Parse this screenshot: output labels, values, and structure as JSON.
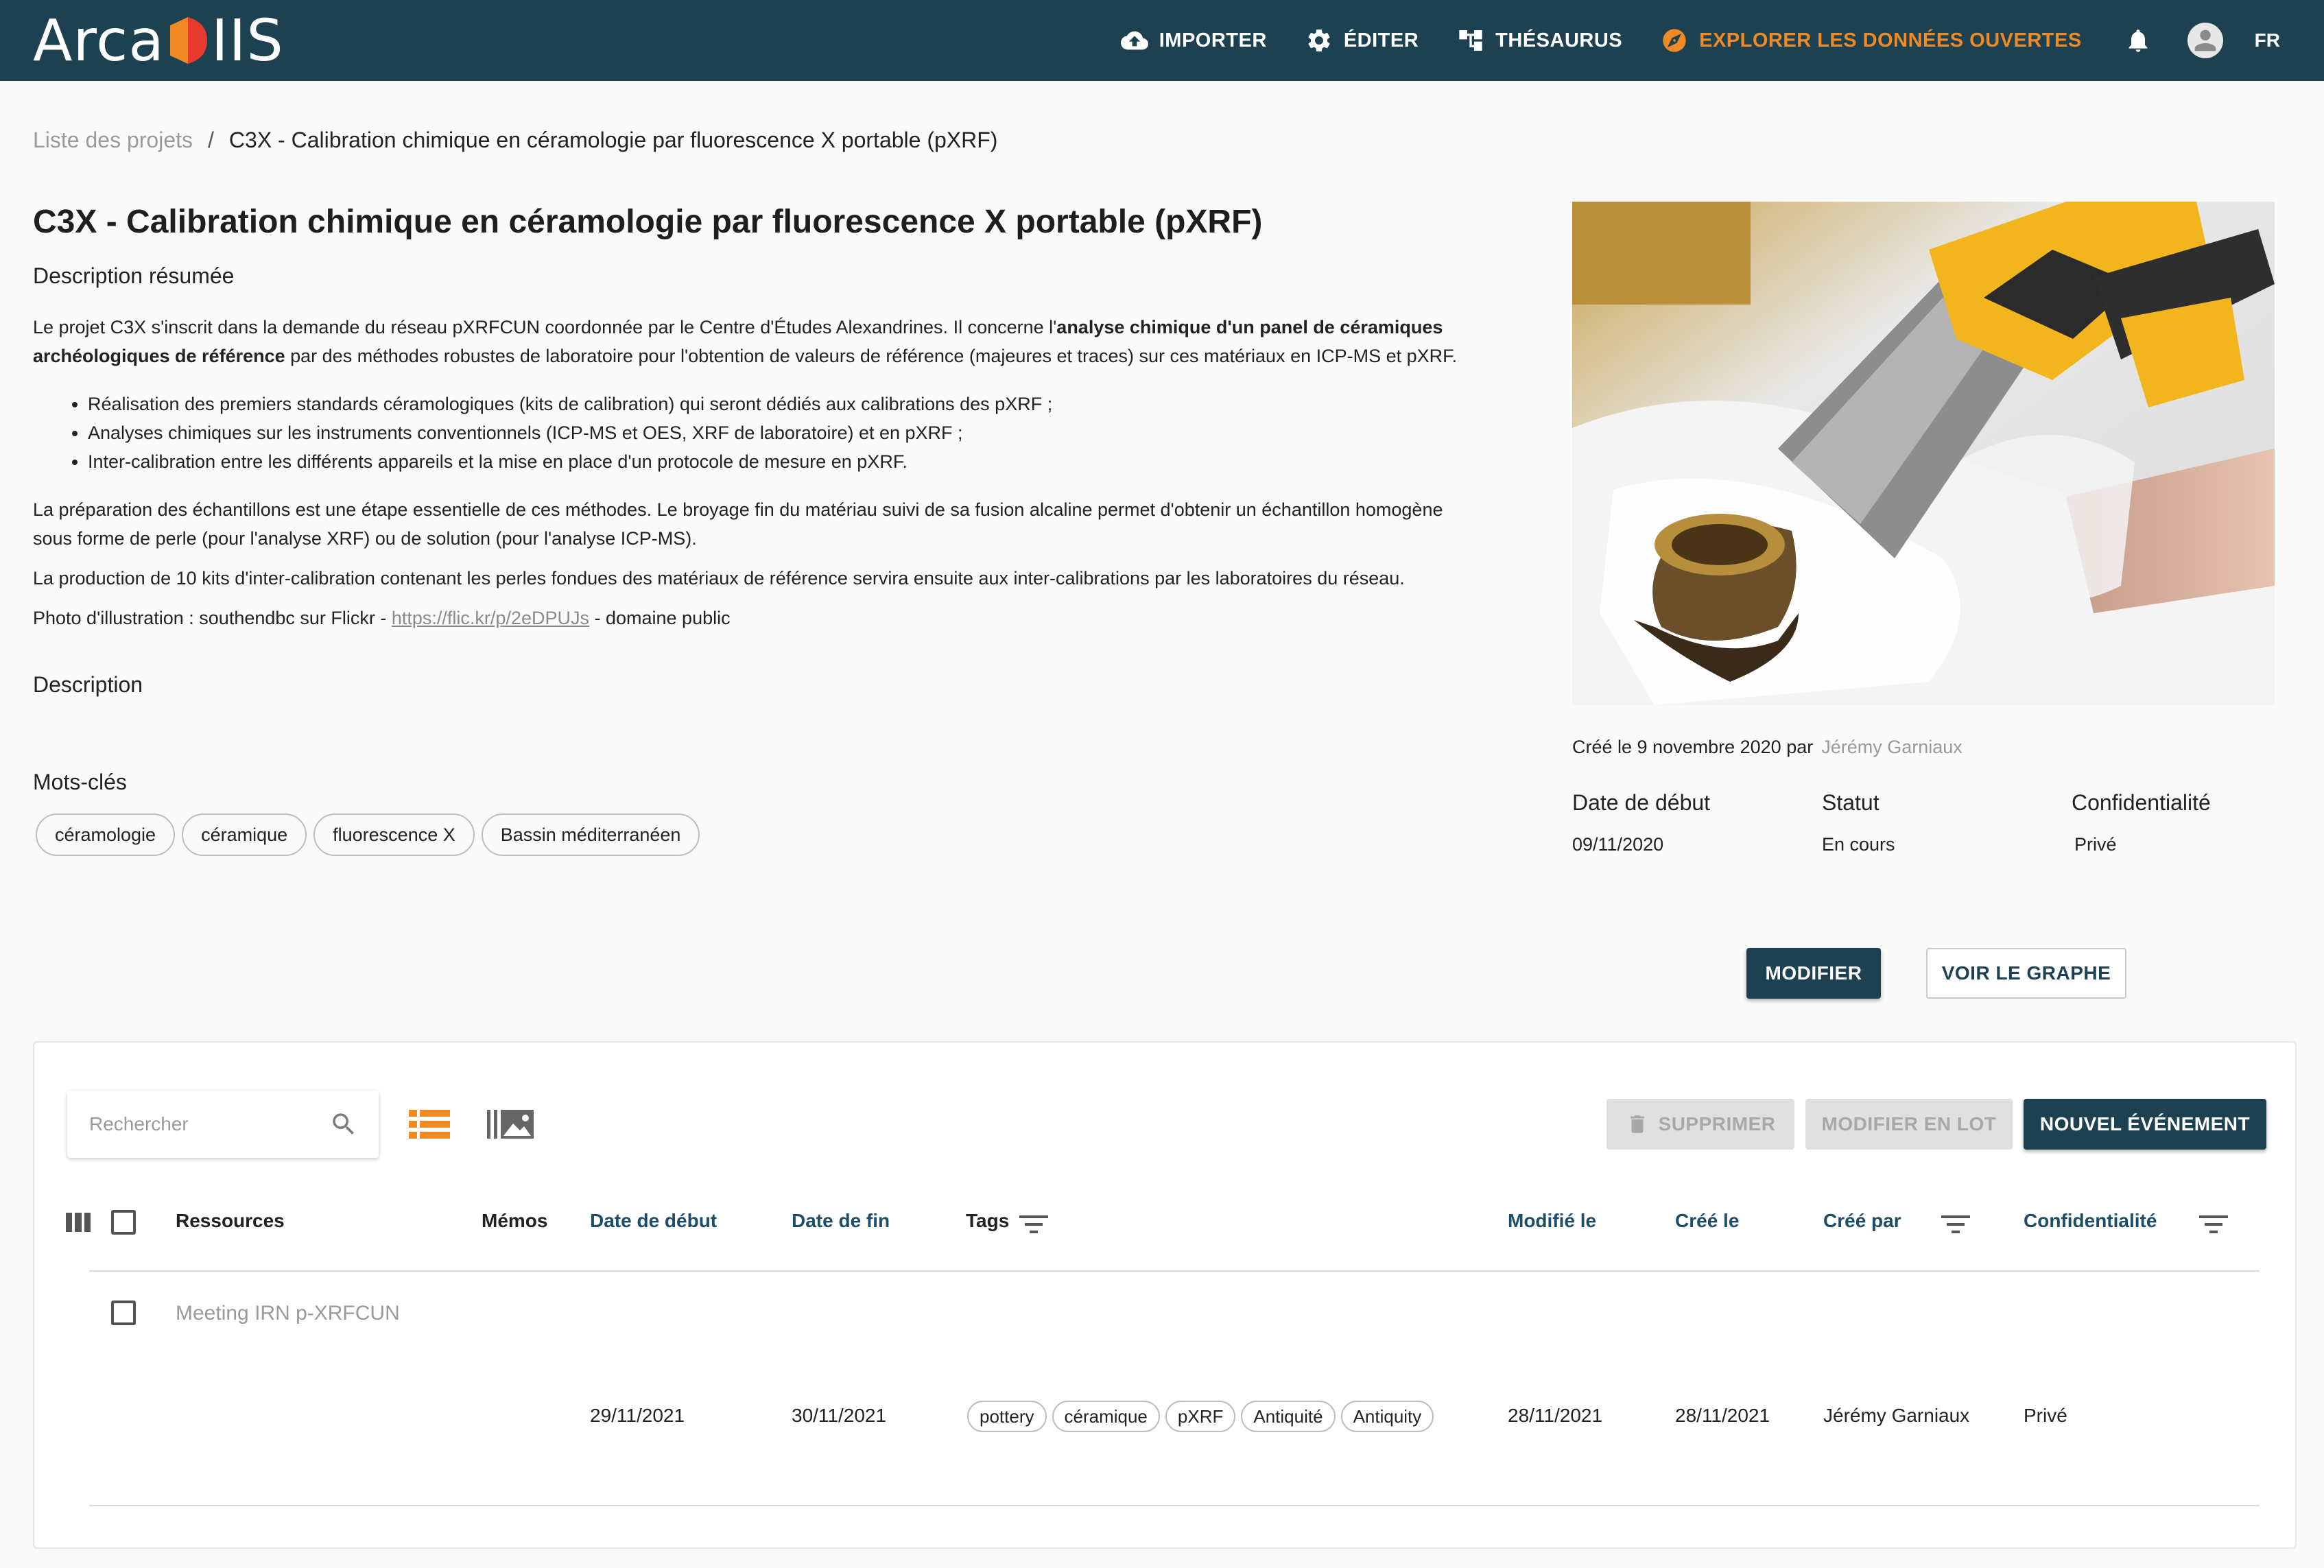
{
  "app": {
    "logo_text_left": "Arca",
    "logo_text_right": "IIS"
  },
  "nav": {
    "items": [
      {
        "label": "IMPORTER",
        "icon": "cloud-upload-icon"
      },
      {
        "label": "ÉDITER",
        "icon": "gear-icon"
      },
      {
        "label": "THÉSAURUS",
        "icon": "hierarchy-icon"
      },
      {
        "label": "EXPLORER LES DONNÉES OUVERTES",
        "icon": "compass-icon",
        "color": "#f08a24"
      }
    ],
    "lang": "FR"
  },
  "breadcrumb": {
    "parent": "Liste des projets",
    "separator": "/",
    "current": "C3X - Calibration chimique en céramologie par fluorescence X portable (pXRF)"
  },
  "project": {
    "title": "C3X - Calibration chimique en céramologie par fluorescence X portable (pXRF)",
    "summary_heading": "Description résumée",
    "p1_before": "Le projet C3X s'inscrit dans la demande du réseau pXRFCUN coordonnée par le Centre d'Études Alexandrines. Il concerne l'",
    "p1_bold_a": "analyse chimique d'un panel de céramiques",
    "p1_bold_b": "archéologiques de référence",
    "p1_line1_end": "",
    "p1_after": " par des méthodes robustes de laboratoire pour l'obtention de valeurs de référence (majeures et traces) sur ces matériaux en ICP-MS et pXRF.",
    "bullets": [
      "Réalisation des premiers standards céramologiques (kits de calibration) qui seront dédiés aux calibrations des pXRF ;",
      "Analyses chimiques sur les instruments conventionnels (ICP-MS et OES, XRF de laboratoire) et en pXRF ;",
      "Inter-calibration entre les différents appareils et la mise en place d'un protocole de mesure en pXRF."
    ],
    "p2_line1": "La préparation des échantillons est une étape essentielle de ces méthodes. Le broyage fin du matériau suivi de sa fusion alcaline permet d'obtenir un échantillon homogène",
    "p2_line2": "sous forme de perle (pour l'analyse XRF) ou de solution (pour l'analyse ICP-MS).",
    "p3": "La production de 10 kits d'inter-calibration contenant les perles fondues des matériaux de référence servira ensuite aux inter-calibrations par les laboratoires du réseau.",
    "photo_credit_before": "Photo d'illustration : southendbc sur Flickr - ",
    "photo_credit_link": "https://flic.kr/p/2eDPUJs",
    "photo_credit_after": " - domaine public",
    "description_heading": "Description",
    "keywords_heading": "Mots-clés",
    "keywords": [
      "céramologie",
      "céramique",
      "fluorescence X",
      "Bassin méditerranéen"
    ],
    "created_text": "Créé le 9 novembre 2020 par",
    "created_by": "Jérémy Garniaux",
    "meta": [
      {
        "label": "Date de début",
        "value": "09/11/2020"
      },
      {
        "label": "Statut",
        "value": "En cours"
      },
      {
        "label": "Confidentialité",
        "value": "Privé"
      }
    ],
    "modify_button": "MODIFIER",
    "graph_button": "VOIR LE GRAPHE"
  },
  "table": {
    "search_placeholder": "Rechercher",
    "delete_button": "SUPPRIMER",
    "batch_button": "MODIFIER EN LOT",
    "new_event_button": "NOUVEL ÉVÉNEMENT",
    "columns": {
      "resources": "Ressources",
      "memos": "Mémos",
      "start": "Date de début",
      "end": "Date de fin",
      "tags": "Tags",
      "modified": "Modifié le",
      "created": "Créé le",
      "created_by": "Créé par",
      "confidentiality": "Confidentialité"
    },
    "rows": [
      {
        "title": "Meeting IRN p-XRFCUN",
        "start": "29/11/2021",
        "end": "30/11/2021",
        "tags": [
          "pottery",
          "céramique",
          "pXRF",
          "Antiquité",
          "Antiquity"
        ],
        "modified": "28/11/2021",
        "created": "28/11/2021",
        "created_by": "Jérémy Garniaux",
        "confidentiality": "Privé"
      }
    ]
  },
  "colors": {
    "header_bg": "#1d4150",
    "accent": "#f08a24",
    "link_blue": "#1d4d68"
  }
}
